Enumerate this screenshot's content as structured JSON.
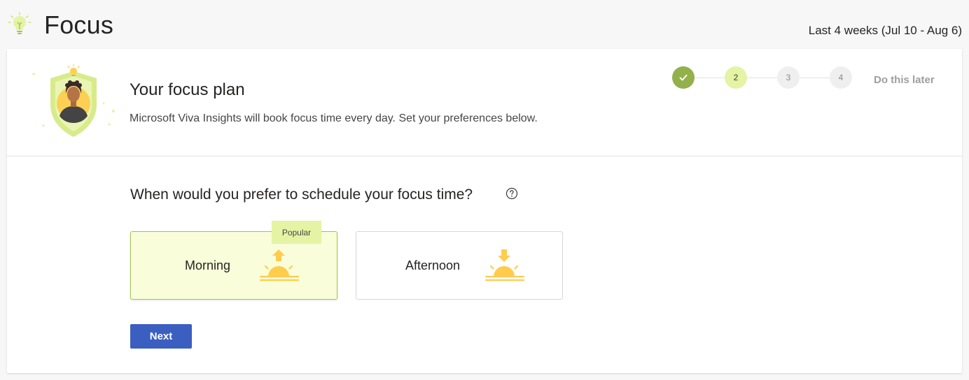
{
  "app": {
    "title": "Focus",
    "icon": "lightbulb-icon",
    "date_range": "Last 4 weeks (Jul 10 - Aug 6)"
  },
  "header": {
    "title": "Your focus plan",
    "subtitle": "Microsoft Viva Insights will book focus time every day. Set your preferences below.",
    "illustration": "person-shield-lightbulb"
  },
  "stepper": {
    "steps": [
      {
        "label": "",
        "state": "done",
        "icon": "check-icon"
      },
      {
        "label": "2",
        "state": "current"
      },
      {
        "label": "3",
        "state": "todo"
      },
      {
        "label": "4",
        "state": "todo"
      }
    ],
    "skip_label": "Do this later"
  },
  "question": {
    "text": "When would you prefer to schedule your focus time?",
    "help_icon": "question-circle-icon"
  },
  "options": [
    {
      "label": "Morning",
      "icon": "sunrise-icon",
      "selected": true,
      "badge": "Popular"
    },
    {
      "label": "Afternoon",
      "icon": "sunset-icon",
      "selected": false
    }
  ],
  "actions": {
    "next_label": "Next"
  },
  "colors": {
    "accent_green": "#92b14a",
    "light_green": "#e4f4a4",
    "selected_bg": "#f9fdd9",
    "button_blue": "#3b5ec1",
    "sun_yellow": "#ffcc4d"
  }
}
